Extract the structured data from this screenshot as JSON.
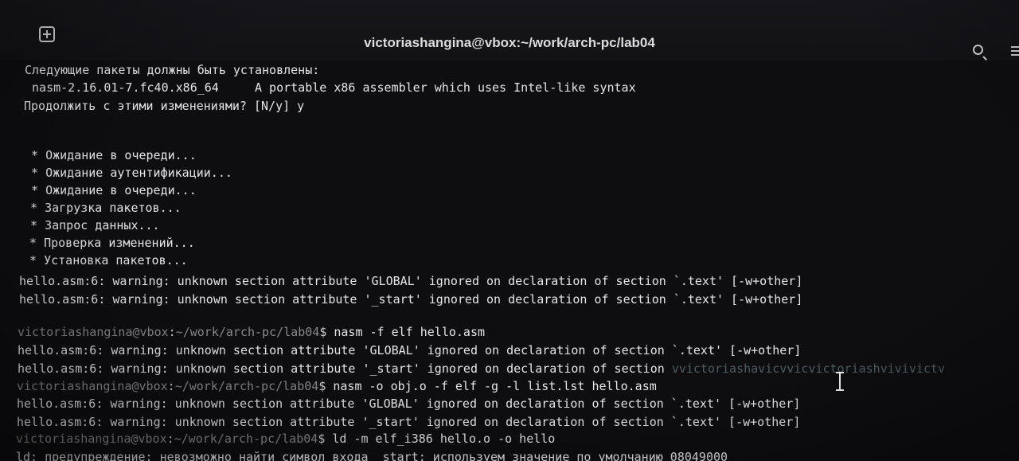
{
  "window": {
    "title": "victoriashangina@vbox:~/work/arch-pc/lab04"
  },
  "icons": {
    "new_tab": "plus-square-icon",
    "search": "search-icon",
    "menu": "hamburger-menu-icon"
  },
  "terminal": {
    "lines": [
      "Следующие пакеты должны быть установлены:",
      " nasm-2.16.01-7.fc40.x86_64     A portable x86 assembler which uses Intel-like syntax",
      "Продолжить с этими изменениями? [N/y] y",
      " * Ожидание в очереди...",
      " * Ожидание аутентификации...",
      " * Ожидание в очереди...",
      " * Загрузка пакетов...",
      " * Запрос данных...",
      " * Проверка изменений...",
      " * Установка пакетов...",
      "hello.asm:6: warning: unknown section attribute 'GLOBAL' ignored on declaration of section `.text' [-w+other]",
      "hello.asm:6: warning: unknown section attribute '_start' ignored on declaration of section `.text' [-w+other]",
      "hello.asm:6: warning: unknown section attribute 'GLOBAL' ignored on declaration of section `.text' [-w+other]",
      "hello.asm:6: warning: unknown section attribute '_start' ignored on declaration of section ",
      "hello.asm:6: warning: unknown section attribute 'GLOBAL' ignored on declaration of section `.text' [-w+other]",
      "hello.asm:6: warning: unknown section attribute '_start' ignored on declaration of section `.text' [-w+other]",
      "ld: предупреждение: невозможно найти символ входа _start; используем значение по умолчанию 08049000"
    ],
    "ghost_text": "vvictoriashavicvvicvictoriashvivivictv",
    "prompt": {
      "user_host": "victoriashangina@vbox",
      "separator": ":",
      "path": "~/work/arch-pc/lab04",
      "symbol": "$"
    },
    "commands": [
      " nasm -f elf hello.asm",
      " nasm -o obj.o -f elf -g -l list.lst hello.asm",
      " ld -m elf_i386 hello.o -o hello"
    ]
  }
}
